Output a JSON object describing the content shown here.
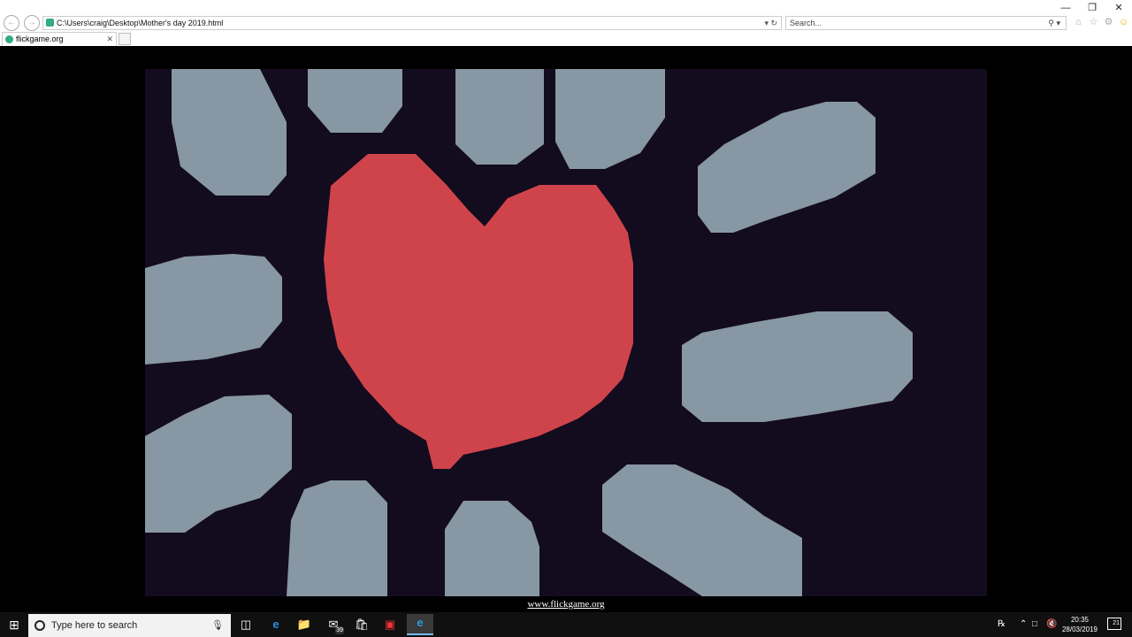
{
  "browser": {
    "address": "C:\\Users\\craig\\Desktop\\Mother's day 2019.html",
    "search_placeholder": "Search...",
    "tab_title": "flickgame.org",
    "window_controls": [
      "—",
      "❐",
      "✕"
    ],
    "tool_icons": [
      "home-icon",
      "star-icon",
      "gear-icon",
      "smiley-icon"
    ]
  },
  "stage": {
    "background": "#130b1e",
    "heart_color": "#cf444b",
    "blob_color": "#8797a3"
  },
  "footer": {
    "link_text": "www.flickgame.org"
  },
  "taskbar": {
    "search_placeholder": "Type here to search",
    "mail_badge": "39",
    "time": "20:35",
    "date": "28/03/2019",
    "notification_count": "21"
  }
}
